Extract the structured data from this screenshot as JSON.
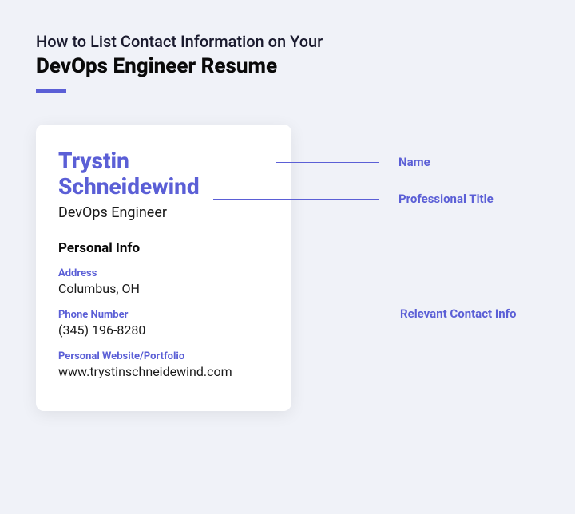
{
  "heading": {
    "line1": "How to List Contact Information on Your",
    "line2": "DevOps Engineer Resume"
  },
  "card": {
    "name": "Trystin Schneidewind",
    "title": "DevOps Engineer",
    "section_header": "Personal Info",
    "address_label": "Address",
    "address_value": "Columbus, OH",
    "phone_label": "Phone Number",
    "phone_value": "(345) 196-8280",
    "website_label": "Personal Website/Portfolio",
    "website_value": "www.trystinschneidewind.com"
  },
  "annotations": {
    "name": "Name",
    "title": "Professional Title",
    "contact": "Relevant Contact Info"
  }
}
